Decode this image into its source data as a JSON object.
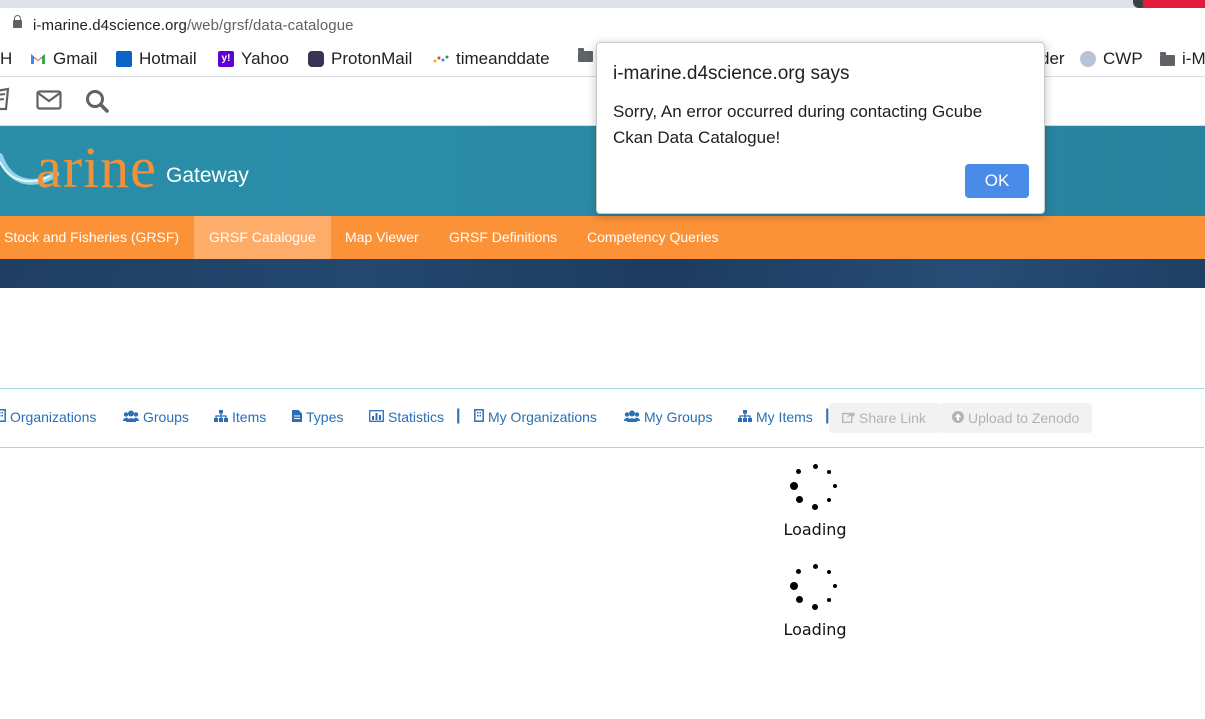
{
  "browser": {
    "url_host": "i-marine.d4science.org",
    "url_path": "/web/grsf/data-catalogue",
    "bookmarks": [
      {
        "label": "H"
      },
      {
        "label": "Gmail"
      },
      {
        "label": "Hotmail"
      },
      {
        "label": "Yahoo"
      },
      {
        "label": "ProtonMail"
      },
      {
        "label": "timeanddate"
      },
      {
        "label": "der"
      },
      {
        "label": "CWP"
      },
      {
        "label": "i-M"
      }
    ]
  },
  "header": {
    "logo_text": "arine",
    "logo_sub": "Gateway"
  },
  "nav": {
    "items": [
      {
        "label": "Stock and Fisheries (GRSF)"
      },
      {
        "label": "GRSF Catalogue"
      },
      {
        "label": "Map Viewer"
      },
      {
        "label": "GRSF Definitions"
      },
      {
        "label": "Competency Queries"
      }
    ]
  },
  "toolbar": {
    "organizations": "Organizations",
    "groups": "Groups",
    "items": "Items",
    "types": "Types",
    "statistics": "Statistics",
    "separator": "|",
    "my_organizations": "My Organizations",
    "my_groups": "My Groups",
    "my_items": "My Items",
    "share_link": "Share Link",
    "upload_zenodo": "Upload to Zenodo"
  },
  "loading": {
    "label": "Loading"
  },
  "dialog": {
    "title": "i-marine.d4science.org says",
    "message": "Sorry, An error occurred during contacting Gcube Ckan Data Catalogue!",
    "ok_label": "OK"
  },
  "colors": {
    "header_teal": "#2a8ea9",
    "nav_orange": "#fc9237",
    "nav_active": "#fdac6a",
    "link_blue": "#2a6fb5",
    "ok_blue": "#4a8ae8"
  }
}
